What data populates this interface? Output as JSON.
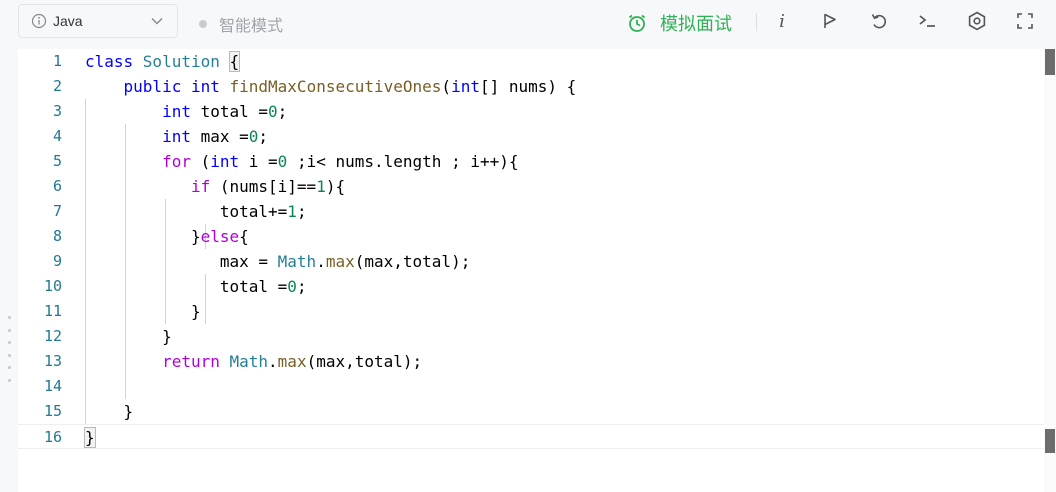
{
  "toolbar": {
    "language": "Java",
    "smart_mode_label": "智能模式",
    "mock_interview_label": "模拟面试",
    "info_char": "i",
    "accent_color": "#2fb255",
    "icons": [
      "info-icon",
      "run-icon",
      "reset-icon",
      "console-icon",
      "settings-icon",
      "fullscreen-icon"
    ]
  },
  "editor": {
    "line_numbers": [
      "1",
      "2",
      "3",
      "4",
      "5",
      "6",
      "7",
      "8",
      "9",
      "10",
      "11",
      "12",
      "13",
      "14",
      "15",
      "16"
    ],
    "lines": [
      [
        {
          "t": "class ",
          "c": "kw"
        },
        {
          "t": "Solution",
          "c": "cl"
        },
        {
          "t": " {",
          "c": ""
        }
      ],
      [
        {
          "t": "    public ",
          "c": "kw"
        },
        {
          "t": "int ",
          "c": "kw"
        },
        {
          "t": "findMaxConsecutiveOnes",
          "c": "fn"
        },
        {
          "t": "(",
          "c": ""
        },
        {
          "t": "int",
          "c": "kw"
        },
        {
          "t": "[] nums) {",
          "c": ""
        }
      ],
      [
        {
          "t": "        int ",
          "c": "kw"
        },
        {
          "t": "total =",
          "c": ""
        },
        {
          "t": "0",
          "c": "num"
        },
        {
          "t": ";",
          "c": ""
        }
      ],
      [
        {
          "t": "        int ",
          "c": "kw"
        },
        {
          "t": "max =",
          "c": ""
        },
        {
          "t": "0",
          "c": "num"
        },
        {
          "t": ";",
          "c": ""
        }
      ],
      [
        {
          "t": "        for ",
          "c": "ctrl"
        },
        {
          "t": "(",
          "c": ""
        },
        {
          "t": "int ",
          "c": "kw"
        },
        {
          "t": "i =",
          "c": ""
        },
        {
          "t": "0",
          "c": "num"
        },
        {
          "t": " ;i< nums.length ; i++){",
          "c": ""
        }
      ],
      [
        {
          "t": "           if ",
          "c": "ctrl"
        },
        {
          "t": "(nums[i]==",
          "c": ""
        },
        {
          "t": "1",
          "c": "num"
        },
        {
          "t": "){",
          "c": ""
        }
      ],
      [
        {
          "t": "              total+=",
          "c": ""
        },
        {
          "t": "1",
          "c": "num"
        },
        {
          "t": ";",
          "c": ""
        }
      ],
      [
        {
          "t": "           }",
          "c": ""
        },
        {
          "t": "else",
          "c": "ctrl"
        },
        {
          "t": "{",
          "c": ""
        }
      ],
      [
        {
          "t": "              max = ",
          "c": ""
        },
        {
          "t": "Math",
          "c": "cl"
        },
        {
          "t": ".",
          "c": ""
        },
        {
          "t": "max",
          "c": "fn"
        },
        {
          "t": "(max,total);",
          "c": ""
        }
      ],
      [
        {
          "t": "              total =",
          "c": ""
        },
        {
          "t": "0",
          "c": "num"
        },
        {
          "t": ";",
          "c": ""
        }
      ],
      [
        {
          "t": "           }",
          "c": ""
        }
      ],
      [
        {
          "t": "        }",
          "c": ""
        }
      ],
      [
        {
          "t": "        return ",
          "c": "ctrl"
        },
        {
          "t": "Math",
          "c": "cl"
        },
        {
          "t": ".",
          "c": ""
        },
        {
          "t": "max",
          "c": "fn"
        },
        {
          "t": "(max,total);",
          "c": ""
        }
      ],
      [
        {
          "t": "",
          "c": ""
        }
      ],
      [
        {
          "t": "    }",
          "c": ""
        }
      ],
      [
        {
          "t": "}",
          "c": ""
        }
      ]
    ]
  }
}
